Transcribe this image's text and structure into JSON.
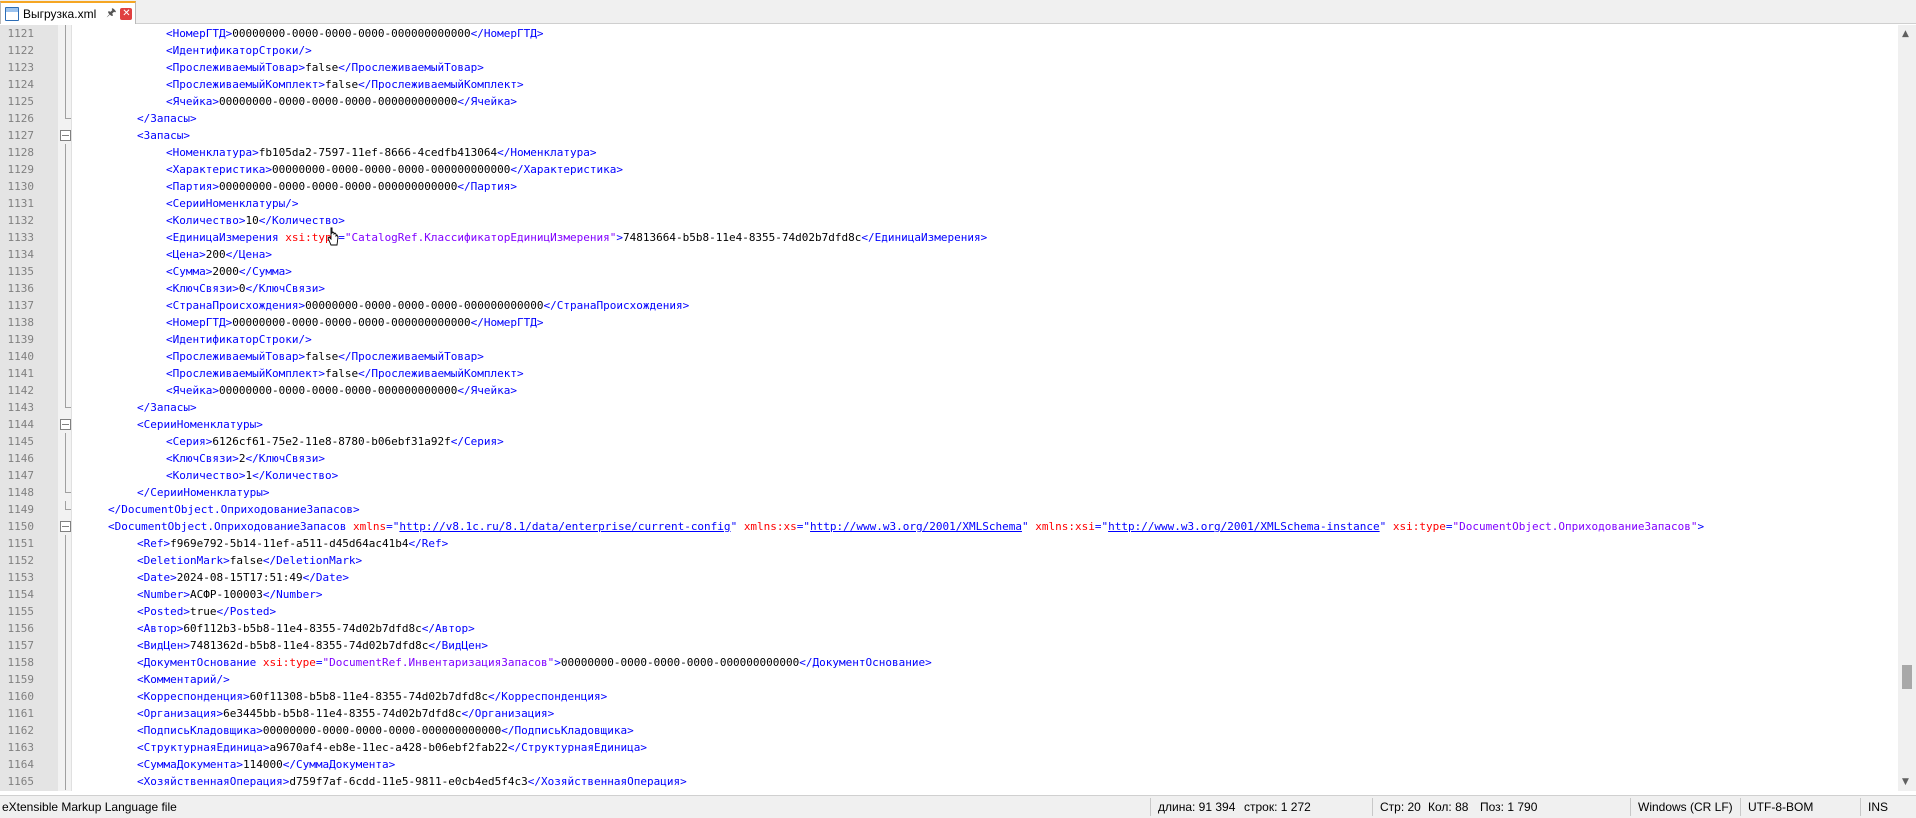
{
  "tab": {
    "label": "Выгрузка.xml"
  },
  "status": {
    "file_type": "eXtensible Markup Language file",
    "length": "длина: 91 394",
    "lines": "строк: 1 272",
    "line": "Стр: 20",
    "col": "Кол: 88",
    "pos": "Поз: 1 790",
    "eol": "Windows (CR LF)",
    "encoding": "UTF-8-BOM",
    "mode": "INS"
  },
  "colors": {
    "tag": "#0000ff",
    "attribute": "#ff0000",
    "attr_value": "#8000ff",
    "text": "#000000",
    "gutter": "#e4e4e4"
  },
  "icons": [
    "file-icon",
    "pin-icon",
    "close-icon",
    "mouse-cursor-icon",
    "scroll-up-icon",
    "scroll-down-icon"
  ],
  "lines": [
    {
      "n": "1121",
      "i": 2,
      "f": "bar",
      "t": [
        [
          "tag",
          "<НомерГТД>"
        ],
        [
          "txt",
          "00000000-0000-0000-0000-000000000000"
        ],
        [
          "tag",
          "</НомерГТД>"
        ]
      ]
    },
    {
      "n": "1122",
      "i": 2,
      "f": "bar",
      "t": [
        [
          "tag",
          "<ИдентификаторСтроки/>"
        ]
      ]
    },
    {
      "n": "1123",
      "i": 2,
      "f": "bar",
      "t": [
        [
          "tag",
          "<ПрослеживаемыйТовар>"
        ],
        [
          "txt",
          "false"
        ],
        [
          "tag",
          "</ПрослеживаемыйТовар>"
        ]
      ]
    },
    {
      "n": "1124",
      "i": 2,
      "f": "bar",
      "t": [
        [
          "tag",
          "<ПрослеживаемыйКомплект>"
        ],
        [
          "txt",
          "false"
        ],
        [
          "tag",
          "</ПрослеживаемыйКомплект>"
        ]
      ]
    },
    {
      "n": "1125",
      "i": 2,
      "f": "bar",
      "t": [
        [
          "tag",
          "<Ячейка>"
        ],
        [
          "txt",
          "00000000-0000-0000-0000-000000000000"
        ],
        [
          "tag",
          "</Ячейка>"
        ]
      ]
    },
    {
      "n": "1126",
      "i": 1,
      "f": "end",
      "t": [
        [
          "tag",
          "</Запасы>"
        ]
      ]
    },
    {
      "n": "1127",
      "i": 1,
      "f": "box",
      "t": [
        [
          "tag",
          "<Запасы>"
        ]
      ]
    },
    {
      "n": "1128",
      "i": 2,
      "f": "bar",
      "t": [
        [
          "tag",
          "<Номенклатура>"
        ],
        [
          "txt",
          "fb105da2-7597-11ef-8666-4cedfb413064"
        ],
        [
          "tag",
          "</Номенклатура>"
        ]
      ]
    },
    {
      "n": "1129",
      "i": 2,
      "f": "bar",
      "t": [
        [
          "tag",
          "<Характеристика>"
        ],
        [
          "txt",
          "00000000-0000-0000-0000-000000000000"
        ],
        [
          "tag",
          "</Характеристика>"
        ]
      ]
    },
    {
      "n": "1130",
      "i": 2,
      "f": "bar",
      "t": [
        [
          "tag",
          "<Партия>"
        ],
        [
          "txt",
          "00000000-0000-0000-0000-000000000000"
        ],
        [
          "tag",
          "</Партия>"
        ]
      ]
    },
    {
      "n": "1131",
      "i": 2,
      "f": "bar",
      "t": [
        [
          "tag",
          "<СерииНоменклатуры/>"
        ]
      ]
    },
    {
      "n": "1132",
      "i": 2,
      "f": "bar",
      "t": [
        [
          "tag",
          "<Количество>"
        ],
        [
          "txt",
          "10"
        ],
        [
          "tag",
          "</Количество>"
        ]
      ]
    },
    {
      "n": "1133",
      "i": 2,
      "f": "bar",
      "t": [
        [
          "tag",
          "<ЕдиницаИзмерения "
        ],
        [
          "attr",
          "xsi:type"
        ],
        [
          "tag",
          "="
        ],
        [
          "val",
          "\"CatalogRef.КлассификаторЕдиницИзмерения\""
        ],
        [
          "tag",
          ">"
        ],
        [
          "txt",
          "74813664-b5b8-11e4-8355-74d02b7dfd8c"
        ],
        [
          "tag",
          "</ЕдиницаИзмерения>"
        ]
      ]
    },
    {
      "n": "1134",
      "i": 2,
      "f": "bar",
      "t": [
        [
          "tag",
          "<Цена>"
        ],
        [
          "txt",
          "200"
        ],
        [
          "tag",
          "</Цена>"
        ]
      ]
    },
    {
      "n": "1135",
      "i": 2,
      "f": "bar",
      "t": [
        [
          "tag",
          "<Сумма>"
        ],
        [
          "txt",
          "2000"
        ],
        [
          "tag",
          "</Сумма>"
        ]
      ]
    },
    {
      "n": "1136",
      "i": 2,
      "f": "bar",
      "t": [
        [
          "tag",
          "<КлючСвязи>"
        ],
        [
          "txt",
          "0"
        ],
        [
          "tag",
          "</КлючСвязи>"
        ]
      ]
    },
    {
      "n": "1137",
      "i": 2,
      "f": "bar",
      "t": [
        [
          "tag",
          "<СтранаПроисхождения>"
        ],
        [
          "txt",
          "00000000-0000-0000-0000-000000000000"
        ],
        [
          "tag",
          "</СтранаПроисхождения>"
        ]
      ]
    },
    {
      "n": "1138",
      "i": 2,
      "f": "bar",
      "t": [
        [
          "tag",
          "<НомерГТД>"
        ],
        [
          "txt",
          "00000000-0000-0000-0000-000000000000"
        ],
        [
          "tag",
          "</НомерГТД>"
        ]
      ]
    },
    {
      "n": "1139",
      "i": 2,
      "f": "bar",
      "t": [
        [
          "tag",
          "<ИдентификаторСтроки/>"
        ]
      ]
    },
    {
      "n": "1140",
      "i": 2,
      "f": "bar",
      "t": [
        [
          "tag",
          "<ПрослеживаемыйТовар>"
        ],
        [
          "txt",
          "false"
        ],
        [
          "tag",
          "</ПрослеживаемыйТовар>"
        ]
      ]
    },
    {
      "n": "1141",
      "i": 2,
      "f": "bar",
      "t": [
        [
          "tag",
          "<ПрослеживаемыйКомплект>"
        ],
        [
          "txt",
          "false"
        ],
        [
          "tag",
          "</ПрослеживаемыйКомплект>"
        ]
      ]
    },
    {
      "n": "1142",
      "i": 2,
      "f": "bar",
      "t": [
        [
          "tag",
          "<Ячейка>"
        ],
        [
          "txt",
          "00000000-0000-0000-0000-000000000000"
        ],
        [
          "tag",
          "</Ячейка>"
        ]
      ]
    },
    {
      "n": "1143",
      "i": 1,
      "f": "end",
      "t": [
        [
          "tag",
          "</Запасы>"
        ]
      ]
    },
    {
      "n": "1144",
      "i": 1,
      "f": "box",
      "t": [
        [
          "tag",
          "<СерииНоменклатуры>"
        ]
      ]
    },
    {
      "n": "1145",
      "i": 2,
      "f": "bar",
      "t": [
        [
          "tag",
          "<Серия>"
        ],
        [
          "txt",
          "6126cf61-75e2-11e8-8780-b06ebf31a92f"
        ],
        [
          "tag",
          "</Серия>"
        ]
      ]
    },
    {
      "n": "1146",
      "i": 2,
      "f": "bar",
      "t": [
        [
          "tag",
          "<КлючСвязи>"
        ],
        [
          "txt",
          "2"
        ],
        [
          "tag",
          "</КлючСвязи>"
        ]
      ]
    },
    {
      "n": "1147",
      "i": 2,
      "f": "bar",
      "t": [
        [
          "tag",
          "<Количество>"
        ],
        [
          "txt",
          "1"
        ],
        [
          "tag",
          "</Количество>"
        ]
      ]
    },
    {
      "n": "1148",
      "i": 1,
      "f": "end",
      "t": [
        [
          "tag",
          "</СерииНоменклатуры>"
        ]
      ]
    },
    {
      "n": "1149",
      "i": 0,
      "f": "end",
      "t": [
        [
          "tag",
          "</DocumentObject.ОприходованиеЗапасов>"
        ]
      ]
    },
    {
      "n": "1150",
      "i": 0,
      "f": "box",
      "t": [
        [
          "tag",
          "<DocumentObject.ОприходованиеЗапасов "
        ],
        [
          "attr",
          "xmlns"
        ],
        [
          "tag",
          "=\""
        ],
        [
          "link",
          "http://v8.1c.ru/8.1/data/enterprise/current-config"
        ],
        [
          "tag",
          "\" "
        ],
        [
          "attr",
          "xmlns:xs"
        ],
        [
          "tag",
          "=\""
        ],
        [
          "link",
          "http://www.w3.org/2001/XMLSchema"
        ],
        [
          "tag",
          "\" "
        ],
        [
          "attr",
          "xmlns:xsi"
        ],
        [
          "tag",
          "=\""
        ],
        [
          "link",
          "http://www.w3.org/2001/XMLSchema-instance"
        ],
        [
          "tag",
          "\" "
        ],
        [
          "attr",
          "xsi:type"
        ],
        [
          "tag",
          "="
        ],
        [
          "val",
          "\"DocumentObject.ОприходованиеЗапасов\""
        ],
        [
          "tag",
          ">"
        ]
      ]
    },
    {
      "n": "1151",
      "i": 1,
      "f": "bar",
      "t": [
        [
          "tag",
          "<Ref>"
        ],
        [
          "txt",
          "f969e792-5b14-11ef-a511-d45d64ac41b4"
        ],
        [
          "tag",
          "</Ref>"
        ]
      ]
    },
    {
      "n": "1152",
      "i": 1,
      "f": "bar",
      "t": [
        [
          "tag",
          "<DeletionMark>"
        ],
        [
          "txt",
          "false"
        ],
        [
          "tag",
          "</DeletionMark>"
        ]
      ]
    },
    {
      "n": "1153",
      "i": 1,
      "f": "bar",
      "t": [
        [
          "tag",
          "<Date>"
        ],
        [
          "txt",
          "2024-08-15T17:51:49"
        ],
        [
          "tag",
          "</Date>"
        ]
      ]
    },
    {
      "n": "1154",
      "i": 1,
      "f": "bar",
      "t": [
        [
          "tag",
          "<Number>"
        ],
        [
          "txt",
          "АСФР-100003"
        ],
        [
          "tag",
          "</Number>"
        ]
      ]
    },
    {
      "n": "1155",
      "i": 1,
      "f": "bar",
      "t": [
        [
          "tag",
          "<Posted>"
        ],
        [
          "txt",
          "true"
        ],
        [
          "tag",
          "</Posted>"
        ]
      ]
    },
    {
      "n": "1156",
      "i": 1,
      "f": "bar",
      "t": [
        [
          "tag",
          "<Автор>"
        ],
        [
          "txt",
          "60f112b3-b5b8-11e4-8355-74d02b7dfd8c"
        ],
        [
          "tag",
          "</Автор>"
        ]
      ]
    },
    {
      "n": "1157",
      "i": 1,
      "f": "bar",
      "t": [
        [
          "tag",
          "<ВидЦен>"
        ],
        [
          "txt",
          "7481362d-b5b8-11e4-8355-74d02b7dfd8c"
        ],
        [
          "tag",
          "</ВидЦен>"
        ]
      ]
    },
    {
      "n": "1158",
      "i": 1,
      "f": "bar",
      "t": [
        [
          "tag",
          "<ДокументОснование "
        ],
        [
          "attr",
          "xsi:type"
        ],
        [
          "tag",
          "="
        ],
        [
          "val",
          "\"DocumentRef.ИнвентаризацияЗапасов\""
        ],
        [
          "tag",
          ">"
        ],
        [
          "txt",
          "00000000-0000-0000-0000-000000000000"
        ],
        [
          "tag",
          "</ДокументОснование>"
        ]
      ]
    },
    {
      "n": "1159",
      "i": 1,
      "f": "bar",
      "t": [
        [
          "tag",
          "<Комментарий/>"
        ]
      ]
    },
    {
      "n": "1160",
      "i": 1,
      "f": "bar",
      "t": [
        [
          "tag",
          "<Корреспонденция>"
        ],
        [
          "txt",
          "60f11308-b5b8-11e4-8355-74d02b7dfd8c"
        ],
        [
          "tag",
          "</Корреспонденция>"
        ]
      ]
    },
    {
      "n": "1161",
      "i": 1,
      "f": "bar",
      "t": [
        [
          "tag",
          "<Организация>"
        ],
        [
          "txt",
          "6e3445bb-b5b8-11e4-8355-74d02b7dfd8c"
        ],
        [
          "tag",
          "</Организация>"
        ]
      ]
    },
    {
      "n": "1162",
      "i": 1,
      "f": "bar",
      "t": [
        [
          "tag",
          "<ПодписьКладовщика>"
        ],
        [
          "txt",
          "00000000-0000-0000-0000-000000000000"
        ],
        [
          "tag",
          "</ПодписьКладовщика>"
        ]
      ]
    },
    {
      "n": "1163",
      "i": 1,
      "f": "bar",
      "t": [
        [
          "tag",
          "<СтруктурнаяЕдиница>"
        ],
        [
          "txt",
          "a9670af4-eb8e-11ec-a428-b06ebf2fab22"
        ],
        [
          "tag",
          "</СтруктурнаяЕдиница>"
        ]
      ]
    },
    {
      "n": "1164",
      "i": 1,
      "f": "bar",
      "t": [
        [
          "tag",
          "<СуммаДокумента>"
        ],
        [
          "txt",
          "114000"
        ],
        [
          "tag",
          "</СуммаДокумента>"
        ]
      ]
    },
    {
      "n": "1165",
      "i": 1,
      "f": "bar",
      "t": [
        [
          "tag",
          "<ХозяйственнаяОперация>"
        ],
        [
          "txt",
          "d759f7af-6cdd-11e5-9811-e0cb4ed5f4c3"
        ],
        [
          "tag",
          "</ХозяйственнаяОперация>"
        ]
      ]
    }
  ]
}
